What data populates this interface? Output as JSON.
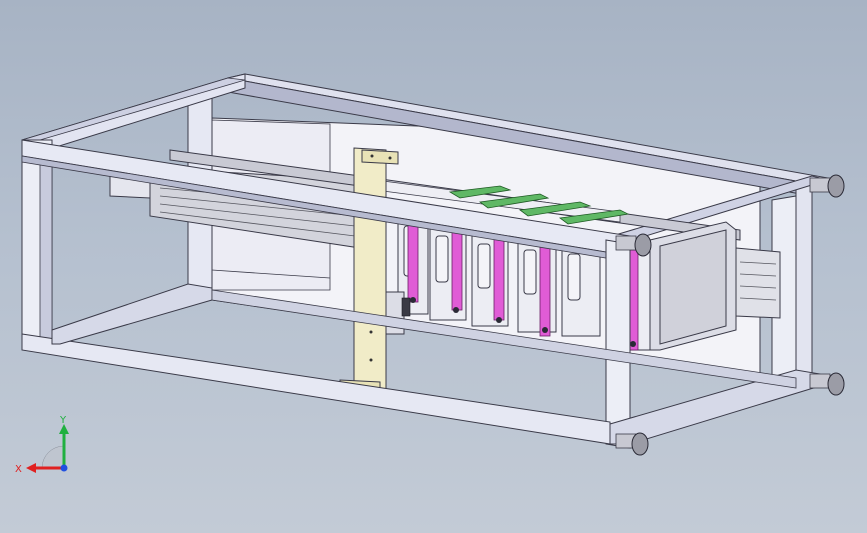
{
  "viewport": {
    "background_top": "#a7b3c4",
    "background_bottom": "#c3cbd6"
  },
  "model": {
    "frame_color": "#e4e6f2",
    "frame_edge": "#3a3a48",
    "frame_shade": "#a9aec6",
    "plate_color": "#f1ecc8",
    "slider_color": "#e05cd6",
    "rail_color": "#5fb865",
    "module_count": 6,
    "leveling_feet": 4
  },
  "triad": {
    "x_label": "X",
    "y_label": "Y",
    "x_color": "#e02020",
    "y_color": "#20b040",
    "z_color": "#2050e0"
  }
}
